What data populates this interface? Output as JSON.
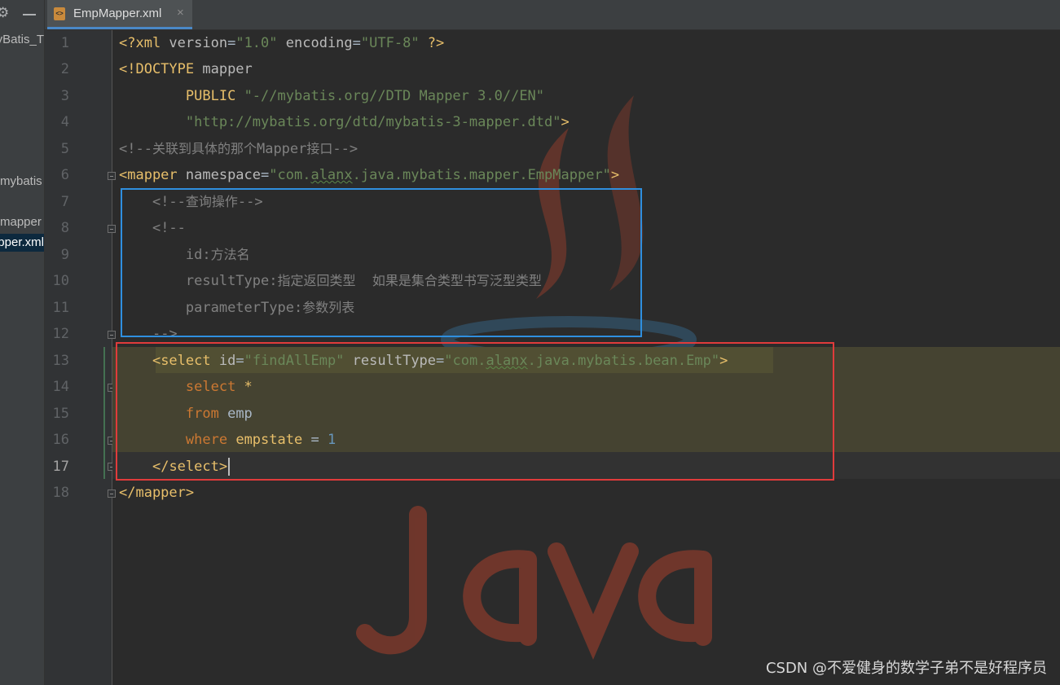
{
  "sidebar": {
    "items": [
      {
        "label": "MyBatis_T"
      },
      {
        "label": "mybatis"
      },
      {
        "label": "mapper"
      },
      {
        "label": "EmpMapper.xml"
      }
    ]
  },
  "tab": {
    "label": "EmpMapper.xml",
    "icon": "xml-file-icon",
    "close": "×"
  },
  "gutter": {
    "lines": [
      "1",
      "2",
      "3",
      "4",
      "5",
      "6",
      "7",
      "8",
      "9",
      "10",
      "11",
      "12",
      "13",
      "14",
      "15",
      "16",
      "17",
      "18"
    ],
    "current_line": "17"
  },
  "code": {
    "l1": {
      "open": "<?xml ",
      "a1": "version",
      "eq1": "=",
      "v1": "\"1.0\"",
      "sp": " ",
      "a2": "encoding",
      "eq2": "=",
      "v2": "\"UTF-8\"",
      "close": " ?>"
    },
    "l2": {
      "open": "<!DOCTYPE ",
      "name": "mapper"
    },
    "l3": {
      "indent": "        ",
      "kw": "PUBLIC",
      "sp": " ",
      "str": "\"-//mybatis.org//DTD Mapper 3.0//EN\""
    },
    "l4": {
      "indent": "        ",
      "str": "\"http://mybatis.org/dtd/mybatis-3-mapper.dtd\"",
      "close": ">"
    },
    "l5": {
      "pre": "<!--",
      "zh": "关联到具体的那个",
      "mid": "Mapper",
      "zh2": "接口",
      "post": "-->"
    },
    "l6": {
      "open": "<mapper ",
      "attr": "namespace",
      "eq": "=",
      "v_pre": "\"com.",
      "v_sq": "alanx",
      "v_post": ".java.mybatis.mapper.EmpMapper\"",
      "close": ">"
    },
    "l7": {
      "indent": "    ",
      "pre": "<!--",
      "zh": "查询操作",
      "post": "-->"
    },
    "l8": {
      "indent": "    ",
      "text": "<!--"
    },
    "l9": {
      "indent": "        ",
      "key": "id:",
      "zh": "方法名"
    },
    "l10": {
      "indent": "        ",
      "key": "resultType:",
      "zh": "指定返回类型    如果是集合类型书写泛型类型"
    },
    "l11": {
      "indent": "        ",
      "key": "parameterType:",
      "zh": "参数列表"
    },
    "l12": {
      "indent": "    ",
      "text": "-->"
    },
    "l13": {
      "indent": "    ",
      "open": "<select",
      "sp": " ",
      "a1": "id",
      "eq1": "=",
      "v1": "\"findAllEmp\"",
      "sp2": " ",
      "a2": "resultType",
      "eq2": "=",
      "v2_pre": "\"com.",
      "v2_sq": "alanx",
      "v2_post": ".java.mybatis.bean.Emp\"",
      "close": ">"
    },
    "l14": {
      "indent": "        ",
      "kw": "select",
      "rest": " *"
    },
    "l15": {
      "indent": "        ",
      "kw": "from",
      "rest": " emp"
    },
    "l16": {
      "indent": "        ",
      "kw": "where",
      "sp": " ",
      "col": "empstate",
      "op": " = ",
      "num": "1"
    },
    "l17": {
      "indent": "    ",
      "open": "</",
      "name": "select",
      "close": ">"
    },
    "l18": {
      "open": "</mapper",
      "close": ">"
    }
  },
  "watermark": "CSDN @不爱健身的数学子弟不是好程序员",
  "colors": {
    "editor_bg": "#2b2b2b",
    "tag": "#e8bf6a",
    "string": "#6a8759",
    "comment": "#808080",
    "keyword": "#cc7832",
    "number": "#6897bb",
    "annotation_blue": "#2f8fdf",
    "annotation_red": "#e03b3b"
  }
}
